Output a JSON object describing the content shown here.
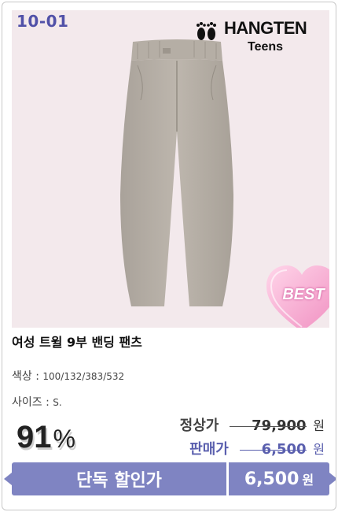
{
  "product": {
    "code": "10-01",
    "brand": {
      "name": "HANGTEN",
      "sub": "Teens"
    },
    "badge": "BEST",
    "title": "여성 트윌 9부 밴딩 팬츠",
    "color_label": "색상 :",
    "color_value": "100/132/383/532",
    "size_label": "사이즈 :",
    "size_value": "S."
  },
  "pricing": {
    "discount": "91",
    "discount_unit": "%",
    "regular_label": "정상가",
    "regular_price": "79,900",
    "sale_label": "판매가",
    "sale_price": "6,500",
    "currency": "원"
  },
  "cta": {
    "label": "단독 할인가",
    "price": "6,500",
    "currency": "원"
  },
  "colors": {
    "accent": "#7f84c2",
    "code_text": "#5151a8",
    "photo_bg": "#f3e9ec",
    "badge_pink": "#f4a6cd"
  }
}
